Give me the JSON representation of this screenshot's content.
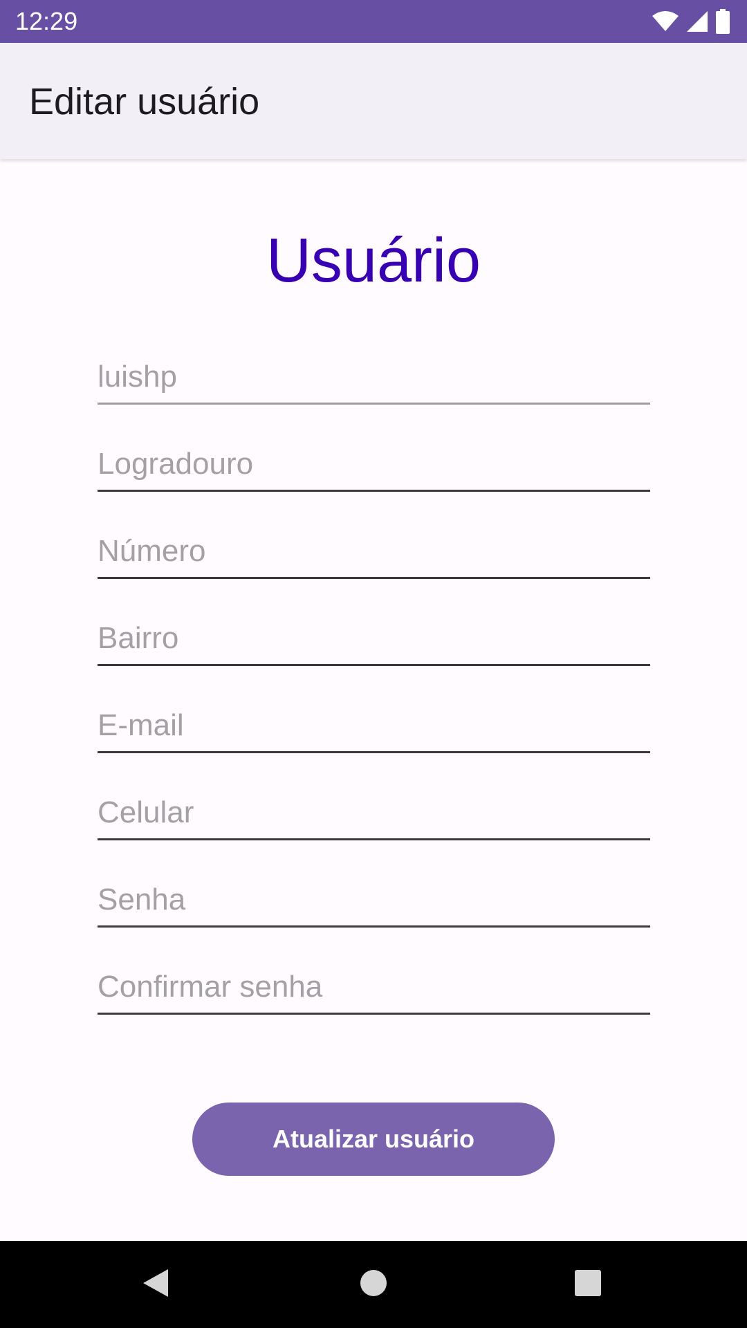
{
  "status_bar": {
    "time": "12:29",
    "icons": [
      "wifi-icon",
      "signal-icon",
      "battery-icon"
    ],
    "background": "#6750a4"
  },
  "app_bar": {
    "title": "Editar usuário"
  },
  "form": {
    "heading": "Usuário",
    "heading_color": "#3700b3",
    "fields": [
      {
        "name": "username",
        "value": "",
        "placeholder": "luishp"
      },
      {
        "name": "logradouro",
        "value": "",
        "placeholder": "Logradouro"
      },
      {
        "name": "numero",
        "value": "",
        "placeholder": "Número"
      },
      {
        "name": "bairro",
        "value": "",
        "placeholder": "Bairro"
      },
      {
        "name": "email",
        "value": "",
        "placeholder": "E-mail"
      },
      {
        "name": "celular",
        "value": "",
        "placeholder": "Celular"
      },
      {
        "name": "senha",
        "value": "",
        "placeholder": "Senha"
      },
      {
        "name": "confirmar-senha",
        "value": "",
        "placeholder": "Confirmar senha"
      }
    ],
    "submit_label": "Atualizar usuário",
    "submit_color": "#7b64ae"
  },
  "nav_bar": {
    "buttons": [
      "back-icon",
      "home-icon",
      "recents-icon"
    ]
  }
}
